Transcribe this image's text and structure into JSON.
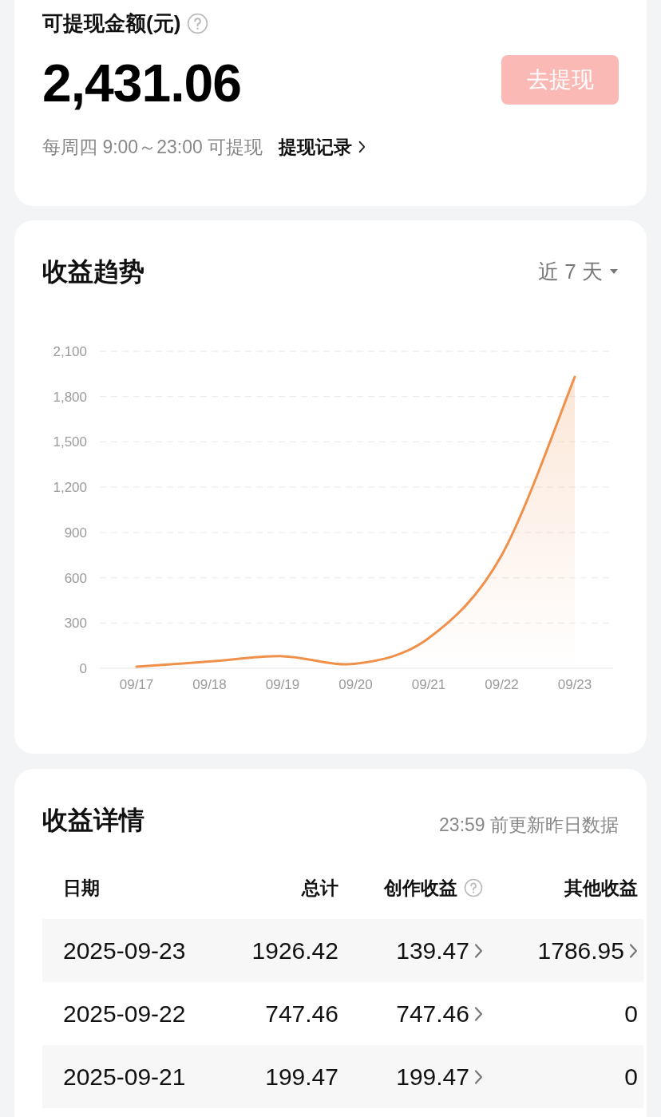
{
  "withdraw": {
    "title": "可提现金额(元)",
    "amount": "2,431.06",
    "button": {
      "label": "去提现",
      "disabled": true
    },
    "schedule": "每周四 9:00～23:00 可提现",
    "records_link": "提现记录"
  },
  "trend": {
    "title": "收益趋势",
    "range": "近 7 天",
    "chart_data": {
      "type": "area",
      "categories": [
        "09/17",
        "09/18",
        "09/19",
        "09/20",
        "09/21",
        "09/22",
        "09/23"
      ],
      "series": [
        {
          "color": "#f0904a",
          "values": [
            10,
            45,
            80,
            30,
            200,
            750,
            1930
          ]
        }
      ],
      "grid": true,
      "ylim": [
        0,
        2100
      ],
      "yticks": [
        {
          "value": 0,
          "label": "0"
        },
        {
          "value": 300,
          "label": "300"
        },
        {
          "value": 600,
          "label": "600"
        },
        {
          "value": 900,
          "label": "900"
        },
        {
          "value": 1200,
          "label": "1,200"
        },
        {
          "value": 1500,
          "label": "1,500"
        },
        {
          "value": 1800,
          "label": "1,800"
        },
        {
          "value": 2100,
          "label": "2,100"
        }
      ]
    }
  },
  "details": {
    "title": "收益详情",
    "note": "23:59 前更新昨日数据",
    "columns": [
      {
        "label": "日期",
        "help": false
      },
      {
        "label": "总计",
        "help": false
      },
      {
        "label": "创作收益",
        "help": true
      },
      {
        "label": "其他收益",
        "help": false
      }
    ],
    "rows": [
      {
        "cells": [
          {
            "text": "2025-09-23",
            "link": false
          },
          {
            "text": "1926.42",
            "link": false
          },
          {
            "text": "139.47",
            "link": true
          },
          {
            "text": "1786.95",
            "link": true
          }
        ]
      },
      {
        "cells": [
          {
            "text": "2025-09-22",
            "link": false
          },
          {
            "text": "747.46",
            "link": false
          },
          {
            "text": "747.46",
            "link": true
          },
          {
            "text": "0",
            "link": false
          }
        ]
      },
      {
        "cells": [
          {
            "text": "2025-09-21",
            "link": false
          },
          {
            "text": "199.47",
            "link": false
          },
          {
            "text": "199.47",
            "link": true
          },
          {
            "text": "0",
            "link": false
          }
        ]
      }
    ]
  }
}
